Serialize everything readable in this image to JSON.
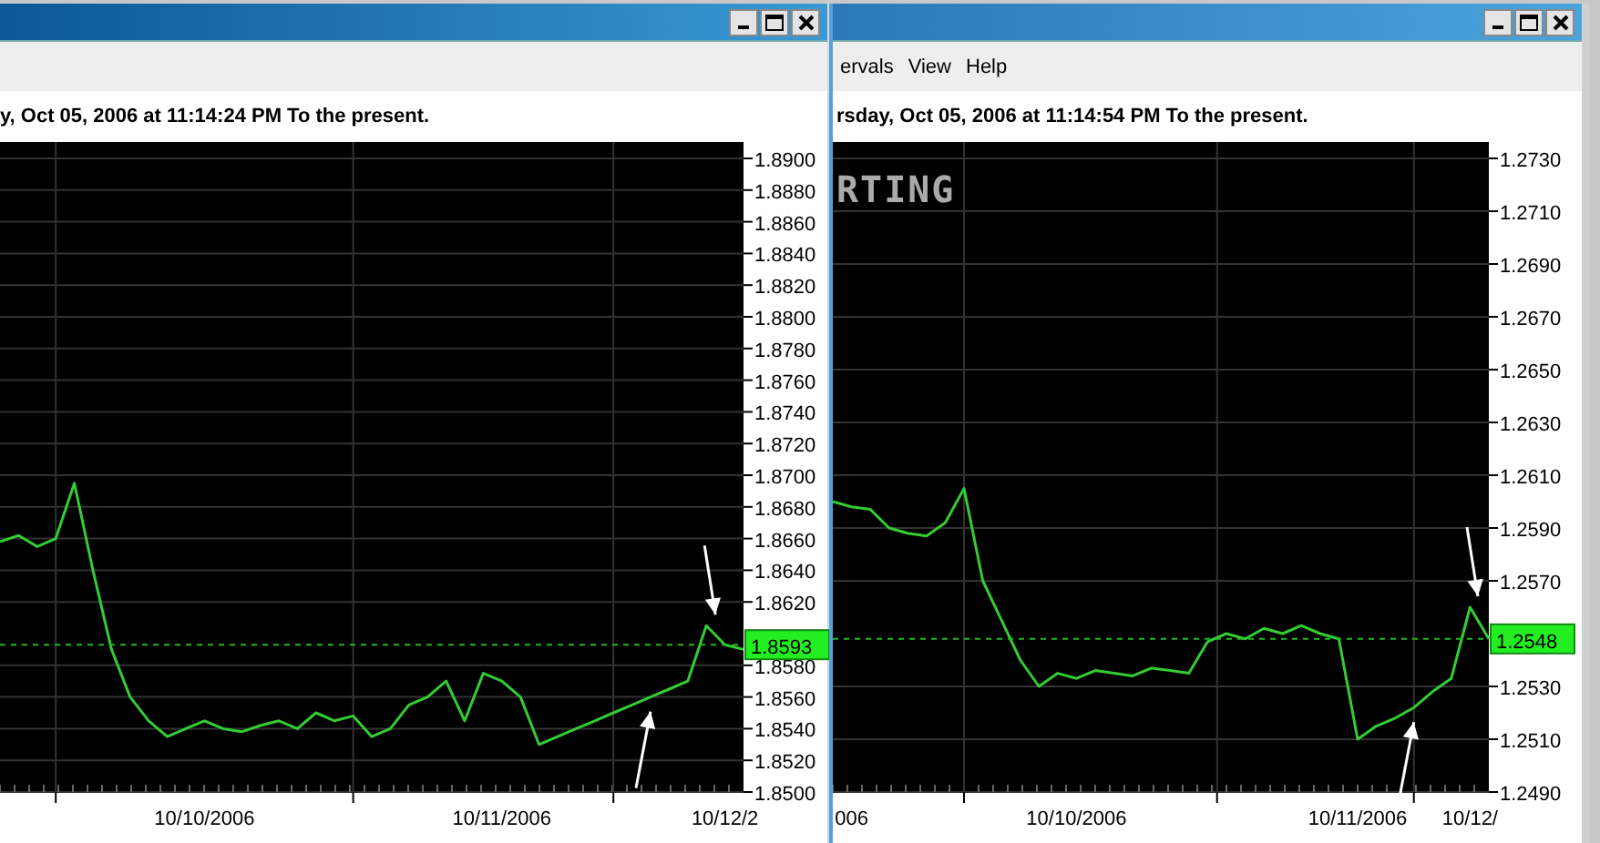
{
  "windows": [
    {
      "header": "y, Oct 05, 2006 at 11:14:24 PM To the present.",
      "chart_data": {
        "type": "line",
        "grid": true,
        "categories": [
          null,
          null,
          null,
          null,
          null,
          null,
          null,
          null,
          null,
          null,
          null,
          "10/10/2006",
          null,
          null,
          null,
          null,
          null,
          null,
          null,
          null,
          null,
          null,
          null,
          null,
          null,
          null,
          null,
          "10/11/2006",
          null,
          null,
          null,
          null,
          null,
          null,
          null,
          null,
          null,
          null,
          null,
          "10/12/2",
          null
        ],
        "series": [
          {
            "color": "#33cc33",
            "values": [
              1.8658,
              1.8662,
              1.8655,
              1.866,
              1.8695,
              1.864,
              1.859,
              1.856,
              1.8545,
              1.8535,
              1.854,
              1.8545,
              1.854,
              1.8538,
              1.8542,
              1.8545,
              1.854,
              1.855,
              1.8545,
              1.8548,
              1.8535,
              1.854,
              1.8555,
              1.856,
              1.857,
              1.8545,
              1.8575,
              1.857,
              1.856,
              1.853,
              1.8535,
              1.854,
              1.8545,
              1.855,
              1.8555,
              1.856,
              1.8565,
              1.857,
              1.8605,
              1.8593,
              1.859
            ]
          }
        ],
        "ylim": [
          1.85,
          1.89
        ],
        "yticks": [
          {
            "value": 1.89,
            "label": "1.8900"
          },
          {
            "value": 1.888,
            "label": "1.8880"
          },
          {
            "value": 1.886,
            "label": "1.8860"
          },
          {
            "value": 1.884,
            "label": "1.8840"
          },
          {
            "value": 1.882,
            "label": "1.8820"
          },
          {
            "value": 1.88,
            "label": "1.8800"
          },
          {
            "value": 1.878,
            "label": "1.8780"
          },
          {
            "value": 1.876,
            "label": "1.8760"
          },
          {
            "value": 1.874,
            "label": "1.8740"
          },
          {
            "value": 1.872,
            "label": "1.8720"
          },
          {
            "value": 1.87,
            "label": "1.8700"
          },
          {
            "value": 1.868,
            "label": "1.8680"
          },
          {
            "value": 1.866,
            "label": "1.8660"
          },
          {
            "value": 1.864,
            "label": "1.8640"
          },
          {
            "value": 1.862,
            "label": "1.8620"
          },
          {
            "value": 1.858,
            "label": "1.8580"
          },
          {
            "value": 1.856,
            "label": "1.8560"
          },
          {
            "value": 1.854,
            "label": "1.8540"
          },
          {
            "value": 1.852,
            "label": "1.8520"
          },
          {
            "value": 1.85,
            "label": "1.8500"
          }
        ],
        "ref_lines": [
          {
            "axis": "y",
            "value": 1.8593,
            "label": "1.8593"
          }
        ]
      }
    },
    {
      "menu": [
        "ervals",
        "View",
        "Help"
      ],
      "header": "rsday, Oct 05, 2006 at 11:14:54 PM To the present.",
      "watermark": "RTING",
      "chart_data": {
        "type": "line",
        "grid": true,
        "categories": [
          null,
          "006",
          null,
          null,
          null,
          null,
          null,
          null,
          null,
          null,
          null,
          null,
          null,
          "10/10/2006",
          null,
          null,
          null,
          null,
          null,
          null,
          null,
          null,
          null,
          null,
          null,
          null,
          null,
          null,
          "10/11/2006",
          null,
          null,
          null,
          null,
          null,
          "10/12/",
          null
        ],
        "series": [
          {
            "color": "#33cc33",
            "values": [
              1.26,
              1.2598,
              1.2597,
              1.259,
              1.2588,
              1.2587,
              1.2592,
              1.2605,
              1.257,
              1.2555,
              1.254,
              1.253,
              1.2535,
              1.2533,
              1.2536,
              1.2535,
              1.2534,
              1.2537,
              1.2536,
              1.2535,
              1.2547,
              1.255,
              1.2548,
              1.2552,
              1.255,
              1.2553,
              1.255,
              1.2548,
              1.251,
              1.2515,
              1.2518,
              1.2522,
              1.2528,
              1.2533,
              1.256,
              1.2548
            ]
          }
        ],
        "ylim": [
          1.249,
          1.273
        ],
        "yticks": [
          {
            "value": 1.273,
            "label": "1.2730"
          },
          {
            "value": 1.271,
            "label": "1.2710"
          },
          {
            "value": 1.269,
            "label": "1.2690"
          },
          {
            "value": 1.267,
            "label": "1.2670"
          },
          {
            "value": 1.265,
            "label": "1.2650"
          },
          {
            "value": 1.263,
            "label": "1.2630"
          },
          {
            "value": 1.261,
            "label": "1.2610"
          },
          {
            "value": 1.259,
            "label": "1.2590"
          },
          {
            "value": 1.257,
            "label": "1.2570"
          },
          {
            "value": 1.253,
            "label": "1.2530"
          },
          {
            "value": 1.251,
            "label": "1.2510"
          },
          {
            "value": 1.249,
            "label": "1.2490"
          }
        ],
        "ref_lines": [
          {
            "axis": "y",
            "value": 1.2548,
            "label": "1.2548"
          }
        ]
      }
    }
  ]
}
